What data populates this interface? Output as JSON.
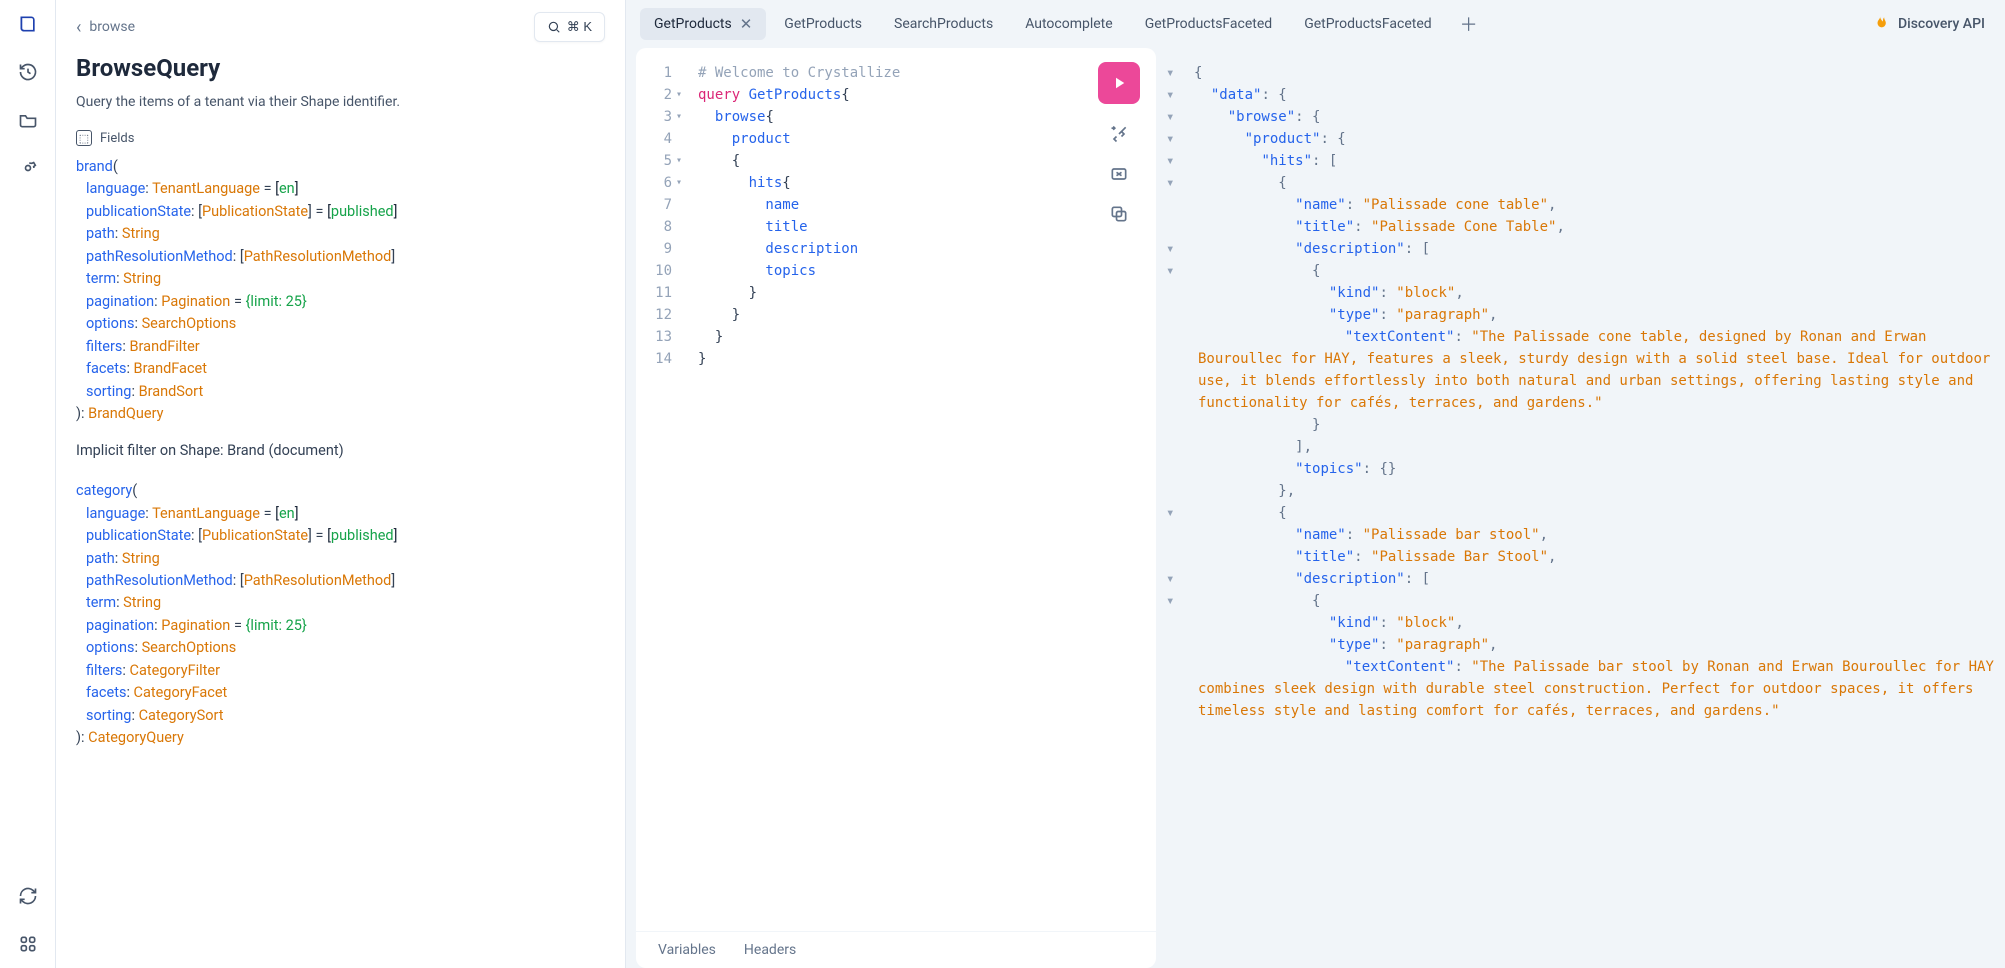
{
  "breadcrumb": {
    "back_arrow": "‹",
    "path": "browse"
  },
  "search_button": {
    "shortcut": "⌘ K"
  },
  "docs": {
    "title": "BrowseQuery",
    "description": "Query the items of a tenant via their Shape identifier.",
    "fields_label": "Fields",
    "entries": [
      {
        "name": "brand",
        "args": [
          {
            "name": "language",
            "type": "TenantLanguage",
            "default": "en",
            "bracket_default": true
          },
          {
            "name": "publicationState",
            "type": "PublicationState",
            "default": "published",
            "bracket_type": true,
            "bracket_default": true
          },
          {
            "name": "path",
            "type": "String"
          },
          {
            "name": "pathResolutionMethod",
            "type": "PathResolutionMethod",
            "bracket_type": true
          },
          {
            "name": "term",
            "type": "String"
          },
          {
            "name": "pagination",
            "type": "Pagination",
            "default": "{limit: 25}"
          },
          {
            "name": "options",
            "type": "SearchOptions"
          },
          {
            "name": "filters",
            "type": "BrandFilter"
          },
          {
            "name": "facets",
            "type": "BrandFacet"
          },
          {
            "name": "sorting",
            "type": "BrandSort"
          }
        ],
        "return_type": "BrandQuery",
        "implicit": "Implicit filter on Shape: Brand (document)"
      },
      {
        "name": "category",
        "args": [
          {
            "name": "language",
            "type": "TenantLanguage",
            "default": "en",
            "bracket_default": true
          },
          {
            "name": "publicationState",
            "type": "PublicationState",
            "default": "published",
            "bracket_type": true,
            "bracket_default": true
          },
          {
            "name": "path",
            "type": "String"
          },
          {
            "name": "pathResolutionMethod",
            "type": "PathResolutionMethod",
            "bracket_type": true
          },
          {
            "name": "term",
            "type": "String"
          },
          {
            "name": "pagination",
            "type": "Pagination",
            "default": "{limit: 25}"
          },
          {
            "name": "options",
            "type": "SearchOptions"
          },
          {
            "name": "filters",
            "type": "CategoryFilter"
          },
          {
            "name": "facets",
            "type": "CategoryFacet"
          },
          {
            "name": "sorting",
            "type": "CategorySort"
          }
        ],
        "return_type": "CategoryQuery"
      }
    ]
  },
  "tabs": {
    "items": [
      {
        "label": "GetProducts",
        "active": true,
        "closable": true
      },
      {
        "label": "GetProducts"
      },
      {
        "label": "SearchProducts"
      },
      {
        "label": "Autocomplete"
      },
      {
        "label": "GetProductsFaceted"
      },
      {
        "label": "GetProductsFaceted"
      }
    ],
    "brand": "Discovery API"
  },
  "editor": {
    "lines": [
      {
        "n": 1,
        "tokens": [
          {
            "t": "# Welcome to Crystallize",
            "c": "tok-comment"
          }
        ]
      },
      {
        "n": 2,
        "fold": true,
        "tokens": [
          {
            "t": "query ",
            "c": "tok-kw"
          },
          {
            "t": "GetProducts",
            "c": "tok-name"
          },
          {
            "t": "{",
            "c": "tok-brace"
          }
        ]
      },
      {
        "n": 3,
        "fold": true,
        "tokens": [
          {
            "t": "  browse",
            "c": "tok-field"
          },
          {
            "t": "{",
            "c": "tok-brace"
          }
        ]
      },
      {
        "n": 4,
        "tokens": [
          {
            "t": "    product",
            "c": "tok-field"
          }
        ]
      },
      {
        "n": 5,
        "fold": true,
        "tokens": [
          {
            "t": "    {",
            "c": "tok-brace"
          }
        ]
      },
      {
        "n": 6,
        "fold": true,
        "tokens": [
          {
            "t": "      hits",
            "c": "tok-field"
          },
          {
            "t": "{",
            "c": "tok-brace"
          }
        ]
      },
      {
        "n": 7,
        "tokens": [
          {
            "t": "        name",
            "c": "tok-field"
          }
        ]
      },
      {
        "n": 8,
        "tokens": [
          {
            "t": "        title",
            "c": "tok-field"
          }
        ]
      },
      {
        "n": 9,
        "tokens": [
          {
            "t": "        description",
            "c": "tok-field"
          }
        ]
      },
      {
        "n": 10,
        "tokens": [
          {
            "t": "        topics",
            "c": "tok-field"
          }
        ]
      },
      {
        "n": 11,
        "tokens": [
          {
            "t": "      }",
            "c": "tok-brace"
          }
        ]
      },
      {
        "n": 12,
        "tokens": [
          {
            "t": "    }",
            "c": "tok-brace"
          }
        ]
      },
      {
        "n": 13,
        "tokens": [
          {
            "t": "  }",
            "c": "tok-brace"
          }
        ]
      },
      {
        "n": 14,
        "tokens": [
          {
            "t": "}",
            "c": "tok-brace"
          }
        ]
      }
    ],
    "footer": {
      "variables": "Variables",
      "headers": "Headers"
    }
  },
  "result": {
    "lines": [
      {
        "i": 0,
        "a": true,
        "h": "<span class='jb'>{</span>"
      },
      {
        "i": 1,
        "a": true,
        "h": "<span class='jk'>\"data\"</span><span class='jp'>: </span><span class='jb'>{</span>"
      },
      {
        "i": 2,
        "a": true,
        "h": "<span class='jk'>\"browse\"</span><span class='jp'>: </span><span class='jb'>{</span>"
      },
      {
        "i": 3,
        "a": true,
        "h": "<span class='jk'>\"product\"</span><span class='jp'>: </span><span class='jb'>{</span>"
      },
      {
        "i": 4,
        "a": true,
        "h": "<span class='jk'>\"hits\"</span><span class='jp'>: </span><span class='jb'>[</span>"
      },
      {
        "i": 5,
        "a": true,
        "h": "<span class='jb'>{</span>"
      },
      {
        "i": 6,
        "h": "<span class='jk'>\"name\"</span><span class='jp'>: </span><span class='js'>\"Palissade cone table\"</span><span class='jp'>,</span>"
      },
      {
        "i": 6,
        "h": "<span class='jk'>\"title\"</span><span class='jp'>: </span><span class='js'>\"Palissade Cone Table\"</span><span class='jp'>,</span>"
      },
      {
        "i": 6,
        "a": true,
        "h": "<span class='jk'>\"description\"</span><span class='jp'>: </span><span class='jb'>[</span>"
      },
      {
        "i": 7,
        "a": true,
        "h": "<span class='jb'>{</span>"
      },
      {
        "i": 8,
        "h": "<span class='jk'>\"kind\"</span><span class='jp'>: </span><span class='js'>\"block\"</span><span class='jp'>,</span>"
      },
      {
        "i": 8,
        "h": "<span class='jk'>\"type\"</span><span class='jp'>: </span><span class='js'>\"paragraph\"</span><span class='jp'>,</span>"
      },
      {
        "i": 8,
        "wrap": true,
        "h": "<span class='jk'>\"textContent\"</span><span class='jp'>: </span><span class='js'>\"The Palissade cone table, designed by Ronan and Erwan Bouroullec for HAY, features a sleek, sturdy design with a solid steel base. Ideal for outdoor use, it blends effortlessly into both natural and urban settings, offering lasting style and functionality for cafés, terraces, and gardens.\"</span>"
      },
      {
        "i": 7,
        "h": "<span class='jb'>}</span>"
      },
      {
        "i": 6,
        "h": "<span class='jb'>]</span><span class='jp'>,</span>"
      },
      {
        "i": 6,
        "h": "<span class='jk'>\"topics\"</span><span class='jp'>: </span><span class='jb'>{}</span>"
      },
      {
        "i": 5,
        "h": "<span class='jb'>}</span><span class='jp'>,</span>"
      },
      {
        "i": 5,
        "a": true,
        "h": "<span class='jb'>{</span>"
      },
      {
        "i": 6,
        "h": "<span class='jk'>\"name\"</span><span class='jp'>: </span><span class='js'>\"Palissade bar stool\"</span><span class='jp'>,</span>"
      },
      {
        "i": 6,
        "h": "<span class='jk'>\"title\"</span><span class='jp'>: </span><span class='js'>\"Palissade Bar Stool\"</span><span class='jp'>,</span>"
      },
      {
        "i": 6,
        "a": true,
        "h": "<span class='jk'>\"description\"</span><span class='jp'>: </span><span class='jb'>[</span>"
      },
      {
        "i": 7,
        "a": true,
        "h": "<span class='jb'>{</span>"
      },
      {
        "i": 8,
        "h": "<span class='jk'>\"kind\"</span><span class='jp'>: </span><span class='js'>\"block\"</span><span class='jp'>,</span>"
      },
      {
        "i": 8,
        "h": "<span class='jk'>\"type\"</span><span class='jp'>: </span><span class='js'>\"paragraph\"</span><span class='jp'>,</span>"
      },
      {
        "i": 8,
        "wrap": true,
        "h": "<span class='jk'>\"textContent\"</span><span class='jp'>: </span><span class='js'>\"The Palissade bar stool by Ronan and Erwan Bouroullec for HAY combines sleek design with durable steel construction. Perfect for outdoor spaces, it offers timeless style and lasting comfort for cafés, terraces, and gardens.\"</span>"
      }
    ]
  }
}
